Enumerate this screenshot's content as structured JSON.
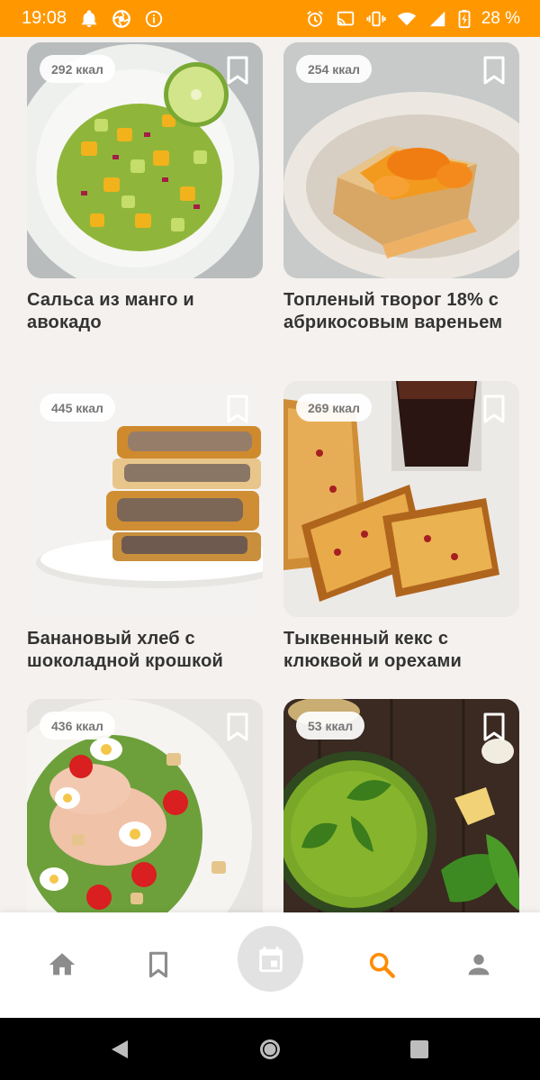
{
  "status_bar": {
    "time": "19:08",
    "battery": "28 %",
    "background": "#ff9800"
  },
  "recipes": [
    {
      "kcal": "292 ккал",
      "title": "Сальса из манго и авокадо",
      "image": "mango-avocado-salsa"
    },
    {
      "kcal": "254 ккал",
      "title": "Топленый творог 18% с абрикосовым вареньем",
      "image": "baked-curd-apricot"
    },
    {
      "kcal": "445 ккал",
      "title": "Банановый хлеб с шоколадной крошкой",
      "image": "banana-bread"
    },
    {
      "kcal": "269 ккал",
      "title": "Тыквенный кекс с клюквой и орехами",
      "image": "pumpkin-cake"
    },
    {
      "kcal": "436 ккал",
      "title": "",
      "image": "caesar-salad"
    },
    {
      "kcal": "53 ккал",
      "title": "",
      "image": "pesto"
    }
  ],
  "bottom_nav": {
    "items": [
      "home-icon",
      "bookmark-icon",
      "calendar-icon",
      "search-icon",
      "person-icon"
    ],
    "active": "search-icon",
    "active_color": "#ff8c00",
    "inactive_color": "#8c8c8c"
  },
  "system_nav": [
    "back-icon",
    "home-circle-icon",
    "recents-icon"
  ]
}
